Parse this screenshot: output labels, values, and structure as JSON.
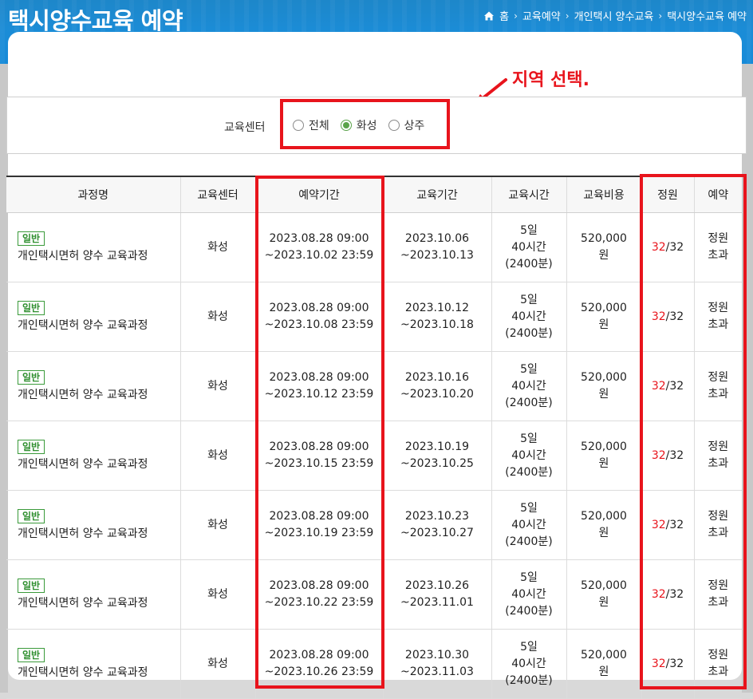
{
  "header": {
    "title": "택시양수교육 예약",
    "breadcrumb": [
      "홈",
      "교육예약",
      "개인택시 양수교육",
      "택시양수교육 예약"
    ]
  },
  "annotation": {
    "text": "지역 선택."
  },
  "filter": {
    "label": "교육센터",
    "options": [
      {
        "label": "전체",
        "checked": false
      },
      {
        "label": "화성",
        "checked": true
      },
      {
        "label": "상주",
        "checked": false
      }
    ]
  },
  "table": {
    "headers": [
      "과정명",
      "교육센터",
      "예약기간",
      "교육기간",
      "교육시간",
      "교육비용",
      "정원",
      "예약"
    ],
    "rows": [
      {
        "tag": "일반",
        "name": "개인택시면허 양수 교육과정",
        "center": "화성",
        "reserve_start": "2023.08.28 09:00",
        "reserve_end": "~2023.10.02 23:59",
        "edu_start": "2023.10.06",
        "edu_end": "~2023.10.13",
        "days": "5일",
        "hours": "40시간",
        "minutes": "(2400분)",
        "price": "520,000",
        "price_unit": "원",
        "cap_now": "32",
        "cap_total": "/32",
        "status_a": "정원",
        "status_b": "초과"
      },
      {
        "tag": "일반",
        "name": "개인택시면허 양수 교육과정",
        "center": "화성",
        "reserve_start": "2023.08.28 09:00",
        "reserve_end": "~2023.10.08 23:59",
        "edu_start": "2023.10.12",
        "edu_end": "~2023.10.18",
        "days": "5일",
        "hours": "40시간",
        "minutes": "(2400분)",
        "price": "520,000",
        "price_unit": "원",
        "cap_now": "32",
        "cap_total": "/32",
        "status_a": "정원",
        "status_b": "초과"
      },
      {
        "tag": "일반",
        "name": "개인택시면허 양수 교육과정",
        "center": "화성",
        "reserve_start": "2023.08.28 09:00",
        "reserve_end": "~2023.10.12 23:59",
        "edu_start": "2023.10.16",
        "edu_end": "~2023.10.20",
        "days": "5일",
        "hours": "40시간",
        "minutes": "(2400분)",
        "price": "520,000",
        "price_unit": "원",
        "cap_now": "32",
        "cap_total": "/32",
        "status_a": "정원",
        "status_b": "초과"
      },
      {
        "tag": "일반",
        "name": "개인택시면허 양수 교육과정",
        "center": "화성",
        "reserve_start": "2023.08.28 09:00",
        "reserve_end": "~2023.10.15 23:59",
        "edu_start": "2023.10.19",
        "edu_end": "~2023.10.25",
        "days": "5일",
        "hours": "40시간",
        "minutes": "(2400분)",
        "price": "520,000",
        "price_unit": "원",
        "cap_now": "32",
        "cap_total": "/32",
        "status_a": "정원",
        "status_b": "초과"
      },
      {
        "tag": "일반",
        "name": "개인택시면허 양수 교육과정",
        "center": "화성",
        "reserve_start": "2023.08.28 09:00",
        "reserve_end": "~2023.10.19 23:59",
        "edu_start": "2023.10.23",
        "edu_end": "~2023.10.27",
        "days": "5일",
        "hours": "40시간",
        "minutes": "(2400분)",
        "price": "520,000",
        "price_unit": "원",
        "cap_now": "32",
        "cap_total": "/32",
        "status_a": "정원",
        "status_b": "초과"
      },
      {
        "tag": "일반",
        "name": "개인택시면허 양수 교육과정",
        "center": "화성",
        "reserve_start": "2023.08.28 09:00",
        "reserve_end": "~2023.10.22 23:59",
        "edu_start": "2023.10.26",
        "edu_end": "~2023.11.01",
        "days": "5일",
        "hours": "40시간",
        "minutes": "(2400분)",
        "price": "520,000",
        "price_unit": "원",
        "cap_now": "32",
        "cap_total": "/32",
        "status_a": "정원",
        "status_b": "초과"
      },
      {
        "tag": "일반",
        "name": "개인택시면허 양수 교육과정",
        "center": "화성",
        "reserve_start": "2023.08.28 09:00",
        "reserve_end": "~2023.10.26 23:59",
        "edu_start": "2023.10.30",
        "edu_end": "~2023.11.03",
        "days": "5일",
        "hours": "40시간",
        "minutes": "(2400분)",
        "price": "520,000",
        "price_unit": "원",
        "cap_now": "32",
        "cap_total": "/32",
        "status_a": "정원",
        "status_b": "초과"
      }
    ]
  },
  "colors": {
    "banner": "#168ad8",
    "highlight": "#e8141c",
    "tag": "#2f8f2f",
    "radio_checked": "#5aa34a"
  }
}
